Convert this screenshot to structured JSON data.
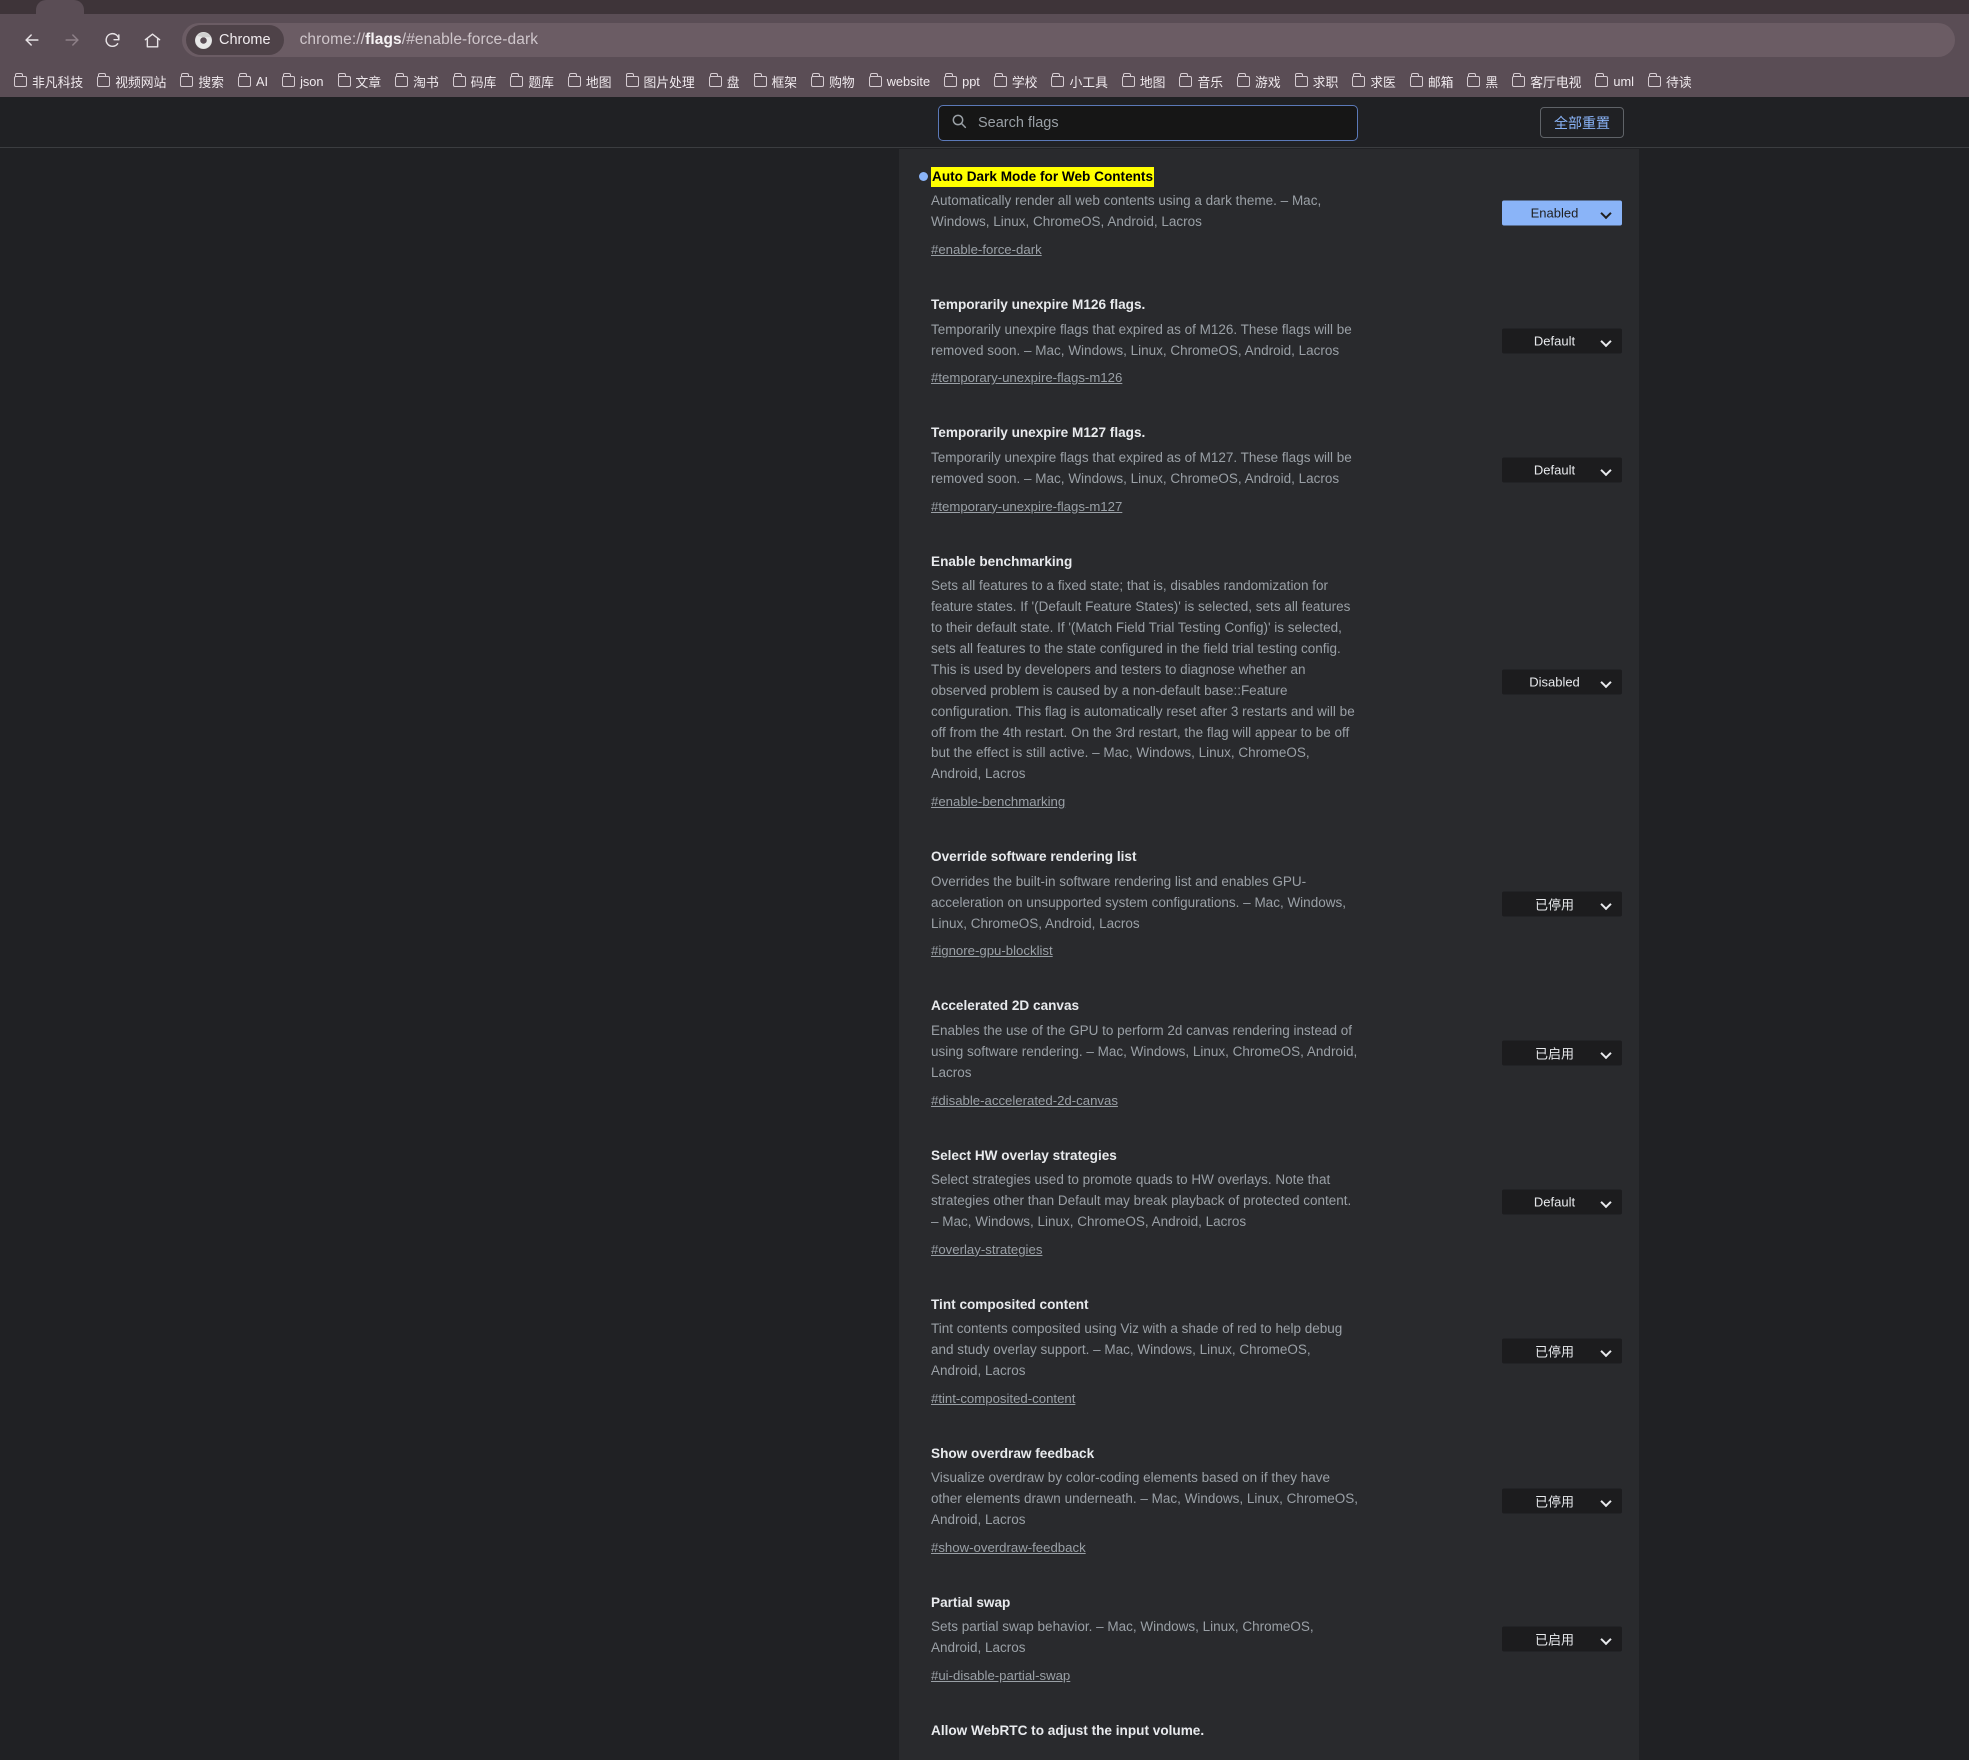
{
  "browser": {
    "url_prefix": "chrome://",
    "url_bold": "flags",
    "url_suffix": "/#enable-force-dark",
    "chrome_chip_label": "Chrome",
    "back_icon": "back-arrow-icon",
    "forward_icon": "forward-arrow-icon",
    "reload_icon": "reload-icon",
    "home_icon": "home-icon"
  },
  "bookmarks": [
    "非凡科技",
    "视频网站",
    "搜索",
    "AI",
    "json",
    "文章",
    "淘书",
    "码库",
    "题库",
    "地图",
    "图片处理",
    "盘",
    "框架",
    "购物",
    "website",
    "ppt",
    "学校",
    "小工具",
    "地图",
    "音乐",
    "游戏",
    "求职",
    "求医",
    "邮箱",
    "黑",
    "客厅电视",
    "uml",
    "待读"
  ],
  "search": {
    "placeholder": "Search flags",
    "value": "",
    "icon": "search-icon"
  },
  "reset_button": {
    "label": "全部重置"
  },
  "colors": {
    "accent": "#8ab4f8",
    "highlight": "#ffff00",
    "card_bg": "#292a2d",
    "page_bg": "#202124",
    "toolbar_bg": "#5a4d55"
  },
  "flags": [
    {
      "title": "Auto Dark Mode for Web Contents",
      "highlighted": true,
      "bullet": true,
      "description": "Automatically render all web contents using a dark theme. – Mac, Windows, Linux, ChromeOS, Android, Lacros",
      "permalink": "#enable-force-dark",
      "select_value": "Enabled",
      "select_highlighted": true
    },
    {
      "title": "Temporarily unexpire M126 flags.",
      "highlighted": false,
      "bullet": false,
      "description": "Temporarily unexpire flags that expired as of M126. These flags will be removed soon. – Mac, Windows, Linux, ChromeOS, Android, Lacros",
      "permalink": "#temporary-unexpire-flags-m126",
      "select_value": "Default",
      "select_highlighted": false
    },
    {
      "title": "Temporarily unexpire M127 flags.",
      "highlighted": false,
      "bullet": false,
      "description": "Temporarily unexpire flags that expired as of M127. These flags will be removed soon. – Mac, Windows, Linux, ChromeOS, Android, Lacros",
      "permalink": "#temporary-unexpire-flags-m127",
      "select_value": "Default",
      "select_highlighted": false
    },
    {
      "title": "Enable benchmarking",
      "highlighted": false,
      "bullet": false,
      "description": "Sets all features to a fixed state; that is, disables randomization for feature states. If '(Default Feature States)' is selected, sets all features to their default state. If '(Match Field Trial Testing Config)' is selected, sets all features to the state configured in the field trial testing config. This is used by developers and testers to diagnose whether an observed problem is caused by a non-default base::Feature configuration. This flag is automatically reset after 3 restarts and will be off from the 4th restart. On the 3rd restart, the flag will appear to be off but the effect is still active. – Mac, Windows, Linux, ChromeOS, Android, Lacros",
      "permalink": "#enable-benchmarking",
      "select_value": "Disabled",
      "select_highlighted": false
    },
    {
      "title": "Override software rendering list",
      "highlighted": false,
      "bullet": false,
      "description": "Overrides the built-in software rendering list and enables GPU-acceleration on unsupported system configurations. – Mac, Windows, Linux, ChromeOS, Android, Lacros",
      "permalink": "#ignore-gpu-blocklist",
      "select_value": "已停用",
      "select_highlighted": false
    },
    {
      "title": "Accelerated 2D canvas",
      "highlighted": false,
      "bullet": false,
      "description": "Enables the use of the GPU to perform 2d canvas rendering instead of using software rendering. – Mac, Windows, Linux, ChromeOS, Android, Lacros",
      "permalink": "#disable-accelerated-2d-canvas",
      "select_value": "已启用",
      "select_highlighted": false
    },
    {
      "title": "Select HW overlay strategies",
      "highlighted": false,
      "bullet": false,
      "description": "Select strategies used to promote quads to HW overlays. Note that strategies other than Default may break playback of protected content. – Mac, Windows, Linux, ChromeOS, Android, Lacros",
      "permalink": "#overlay-strategies",
      "select_value": "Default",
      "select_highlighted": false
    },
    {
      "title": "Tint composited content",
      "highlighted": false,
      "bullet": false,
      "description": "Tint contents composited using Viz with a shade of red to help debug and study overlay support. – Mac, Windows, Linux, ChromeOS, Android, Lacros",
      "permalink": "#tint-composited-content",
      "select_value": "已停用",
      "select_highlighted": false
    },
    {
      "title": "Show overdraw feedback",
      "highlighted": false,
      "bullet": false,
      "description": "Visualize overdraw by color-coding elements based on if they have other elements drawn underneath. – Mac, Windows, Linux, ChromeOS, Android, Lacros",
      "permalink": "#show-overdraw-feedback",
      "select_value": "已停用",
      "select_highlighted": false
    },
    {
      "title": "Partial swap",
      "highlighted": false,
      "bullet": false,
      "description": "Sets partial swap behavior. – Mac, Windows, Linux, ChromeOS, Android, Lacros",
      "permalink": "#ui-disable-partial-swap",
      "select_value": "已启用",
      "select_highlighted": false
    },
    {
      "title": "Allow WebRTC to adjust the input volume.",
      "highlighted": false,
      "bullet": false,
      "description": "",
      "permalink": "",
      "select_value": "",
      "select_highlighted": false
    }
  ]
}
